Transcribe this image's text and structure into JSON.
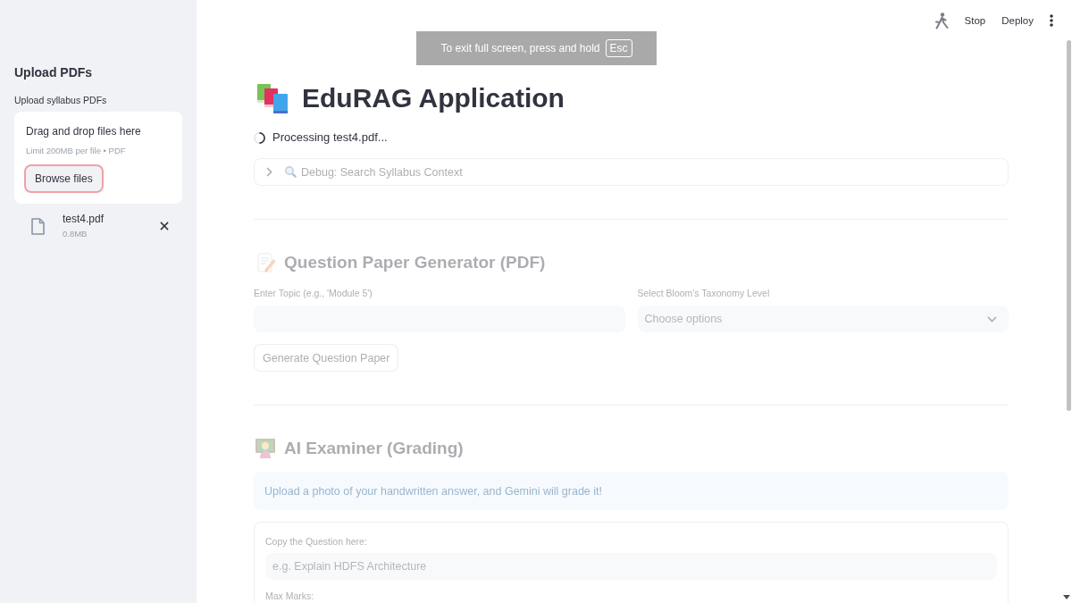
{
  "toast": {
    "text": "To exit full screen, press and hold",
    "key": "Esc"
  },
  "sidebar": {
    "title": "Upload PDFs",
    "uploader": {
      "label": "Upload syllabus PDFs",
      "dropzone_text": "Drag and drop files here",
      "limit_text": "Limit 200MB per file • PDF",
      "browse_button": {
        "label": "Browse files",
        "focused": true
      },
      "files": [
        {
          "name": "test4.pdf",
          "size": "0.8MB"
        }
      ]
    }
  },
  "header": {
    "running": true,
    "buttons": [
      "Stop",
      "Deploy"
    ]
  },
  "main": {
    "title": "EduRAG Application",
    "status": "Processing test4.pdf...",
    "stale": true,
    "expander": {
      "label": "Debug: Search Syllabus Context",
      "expanded": false
    },
    "sections": [
      {
        "kind": "generator",
        "heading": "Question Paper Generator (PDF)",
        "fields": [
          {
            "kind": "text",
            "label": "Enter Topic (e.g., 'Module 5')"
          },
          {
            "kind": "select",
            "label": "Select Bloom's Taxonomy Level",
            "placeholder": "Choose options"
          }
        ],
        "button": "Generate Question Paper"
      },
      {
        "kind": "grader",
        "heading": "AI Examiner (Grading)",
        "info": "Upload a photo of your handwritten answer, and Gemini will grade it!",
        "form": {
          "fields": [
            {
              "kind": "text",
              "label": "Copy the Question here:",
              "placeholder": "e.g. Explain HDFS Architecture"
            },
            {
              "kind": "caption",
              "label": "Max Marks:"
            }
          ]
        }
      }
    ]
  }
}
